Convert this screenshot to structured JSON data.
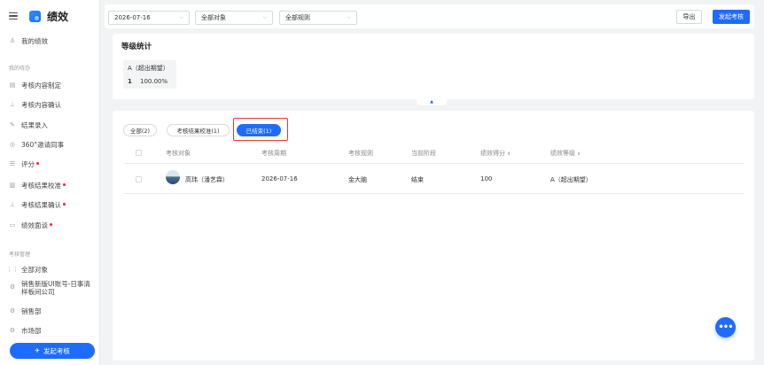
{
  "app": {
    "title": "绩效"
  },
  "sidebar": {
    "my_performance": "我的绩效",
    "section_todo": "我的待办",
    "todo_items": [
      {
        "label": "考核内容制定",
        "badge": false,
        "icon": "doc-icon"
      },
      {
        "label": "考核内容确认",
        "badge": false,
        "icon": "stamp-icon"
      },
      {
        "label": "结果录入",
        "badge": false,
        "icon": "pen-icon"
      },
      {
        "label": "360°邀请同事",
        "badge": false,
        "icon": "circle-icon"
      },
      {
        "label": "评分",
        "badge": true,
        "icon": "list-icon"
      },
      {
        "label": "考核结果校准",
        "badge": true,
        "icon": "calibrate-icon"
      },
      {
        "label": "考核结果确认",
        "badge": true,
        "icon": "stamp-icon"
      },
      {
        "label": "绩效面谈",
        "badge": true,
        "icon": "chat-icon"
      }
    ],
    "section_manage": "考核管理",
    "manage_items": [
      {
        "label": "全部对象",
        "icon": "grid-icon"
      },
      {
        "label": "销售新版UI账号-日事清样板间公司",
        "icon": "gear-icon"
      },
      {
        "label": "销售部",
        "icon": "gear-icon"
      },
      {
        "label": "市场部",
        "icon": "gear-icon"
      }
    ],
    "start_button": "发起考核"
  },
  "filters": {
    "date": "2026-07-16",
    "object": "全部对象",
    "rule": "全部规则",
    "export_label": "导出",
    "start_label": "发起考核"
  },
  "stats": {
    "title": "等级统计",
    "grade_label": "A（超出期望）",
    "grade_count": "1",
    "grade_percent": "100.00%"
  },
  "tabs": [
    {
      "label": "全部(2)",
      "active": false
    },
    {
      "label": "考核结果校准(1)",
      "active": false
    },
    {
      "label": "已结束(1)",
      "active": true
    }
  ],
  "table": {
    "headers": [
      "考核对象",
      "考核周期",
      "考核规则",
      "当前阶段",
      "绩效得分",
      "绩效等级"
    ],
    "rows": [
      {
        "name": "高玮（潘艺霖）",
        "period": "2026-07-16",
        "rule": "金大脑",
        "stage": "结束",
        "score": "100",
        "grade": "A（超出期望）"
      }
    ]
  },
  "colors": {
    "primary": "#1f6bff",
    "badge": "#f5222d",
    "highlight": "#e53935"
  }
}
